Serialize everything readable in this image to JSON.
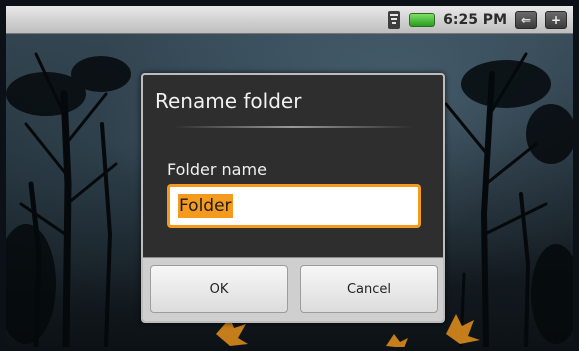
{
  "statusbar": {
    "time": "6:25 PM",
    "icons": [
      "wifi-icon",
      "battery-icon",
      "back-icon",
      "volume-icon"
    ],
    "back_glyph": "⇐",
    "volume_glyph": "+",
    "battery_color": "#3db52a"
  },
  "dialog": {
    "title": "Rename folder",
    "field_label": "Folder name",
    "input_value": "Folder",
    "ok_label": "OK",
    "cancel_label": "Cancel",
    "accent_color": "#f39a1f"
  }
}
